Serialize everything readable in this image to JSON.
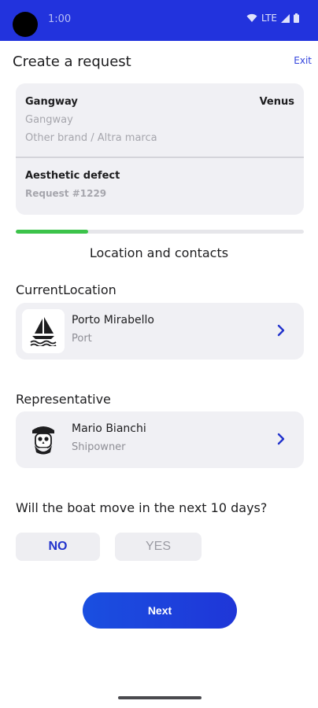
{
  "status_bar": {
    "time": "1:00",
    "network": "LTE",
    "icons": [
      "wifi-icon",
      "signal-icon",
      "battery-icon"
    ]
  },
  "header": {
    "title": "Create a request",
    "exit_label": "Exit"
  },
  "summary": {
    "item_name": "Gangway",
    "brand": "Venus",
    "item_sub": "Gangway",
    "item_brand": "Other brand / Altra marca",
    "defect_title": "Aesthetic defect",
    "request_number": "Request #1229"
  },
  "progress": {
    "fraction": 0.25
  },
  "section": {
    "title": "Location and contacts"
  },
  "location": {
    "label": "CurrentLocation",
    "name": "Porto Mirabello",
    "type": "Port",
    "icon": "sailboat-icon"
  },
  "representative": {
    "label": "Representative",
    "name": "Mario Bianchi",
    "role": "Shipowner",
    "icon": "pirate-avatar-icon"
  },
  "question": {
    "text": "Will the boat move in the next 10 days?",
    "options": [
      "NO",
      "YES"
    ],
    "selected": "NO"
  },
  "actions": {
    "next_label": "Next"
  },
  "colors": {
    "status_bar": "#2233dd",
    "accent": "#2233cc",
    "progress": "#3cc34a",
    "card_bg": "#f0f0f4"
  }
}
